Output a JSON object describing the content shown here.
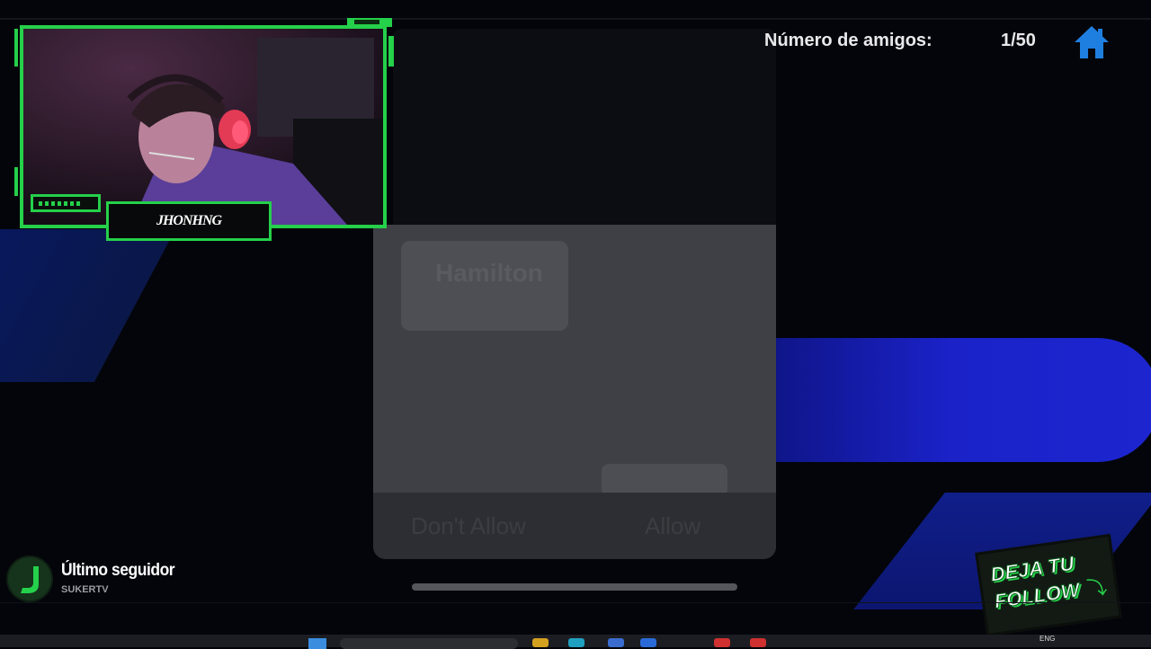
{
  "counter": {
    "label": "Número de amigos:",
    "value": "1/50"
  },
  "webcam": {
    "streamer_name": "JHONHNG"
  },
  "phone_dialog": {
    "card_label": "Hamilton",
    "deny_label": "Don't Allow",
    "allow_label": "Allow"
  },
  "last_follower": {
    "title": "Último seguidor",
    "name": "SUKERTV"
  },
  "follow_badge": {
    "line1": "DEJA TU",
    "line2": "FOLLOW"
  },
  "taskbar": {
    "language": "ENG"
  },
  "colors": {
    "accent_green": "#25d04a",
    "home_blue": "#1f7fe0"
  },
  "icons": [
    "home-icon",
    "follower-logo-icon",
    "arrow-down-icon",
    "windows-start-icon"
  ]
}
